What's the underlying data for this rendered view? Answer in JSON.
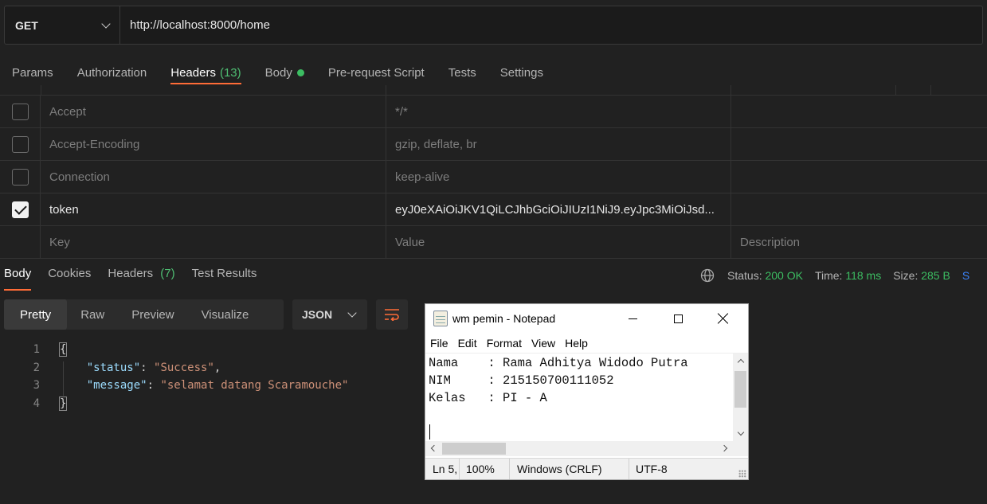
{
  "request": {
    "method": "GET",
    "url": "http://localhost:8000/home"
  },
  "request_tabs": [
    {
      "label": "Params"
    },
    {
      "label": "Authorization"
    },
    {
      "label": "Headers",
      "count": "(13)"
    },
    {
      "label": "Body"
    },
    {
      "label": "Pre-request Script"
    },
    {
      "label": "Tests"
    },
    {
      "label": "Settings"
    }
  ],
  "headers": [
    {
      "key": "Accept",
      "value": "*/*",
      "checked": false
    },
    {
      "key": "Accept-Encoding",
      "value": "gzip, deflate, br",
      "checked": false
    },
    {
      "key": "Connection",
      "value": "keep-alive",
      "checked": false
    },
    {
      "key": "token",
      "value": "eyJ0eXAiOiJKV1QiLCJhbGciOiJIUzI1NiJ9.eyJpc3MiOiJsd...",
      "checked": true
    }
  ],
  "header_placeholders": {
    "key": "Key",
    "value": "Value",
    "description": "Description"
  },
  "response_tabs": [
    {
      "label": "Body"
    },
    {
      "label": "Cookies"
    },
    {
      "label": "Headers",
      "count": "(7)"
    },
    {
      "label": "Test Results"
    }
  ],
  "response_status": {
    "status_label": "Status:",
    "status_value": "200 OK",
    "time_label": "Time:",
    "time_value": "118 ms",
    "size_label": "Size:",
    "size_value": "285 B",
    "cut_text": "S"
  },
  "view_modes": [
    "Pretty",
    "Raw",
    "Preview",
    "Visualize"
  ],
  "format": "JSON",
  "code": {
    "line_numbers": [
      "1",
      "2",
      "3",
      "4"
    ],
    "open_brace": "{",
    "close_brace": "}",
    "status_key": "\"status\"",
    "status_value": "\"Success\"",
    "message_key": "\"message\"",
    "message_value": "\"selamat datang Scaramouche\""
  },
  "notepad": {
    "title": "wm pemin - Notepad",
    "menu": [
      "File",
      "Edit",
      "Format",
      "View",
      "Help"
    ],
    "lines": [
      "Nama    : Rama Adhitya Widodo Putra",
      "NIM     : 215150700111052",
      "Kelas   : PI - A"
    ],
    "status": {
      "position": "Ln 5,",
      "zoom": "100%",
      "line_ending": "Windows (CRLF)",
      "encoding": "UTF-8"
    }
  },
  "colors": {
    "accent": "#ff6c37",
    "success": "#3cbd62",
    "background": "#212121"
  }
}
